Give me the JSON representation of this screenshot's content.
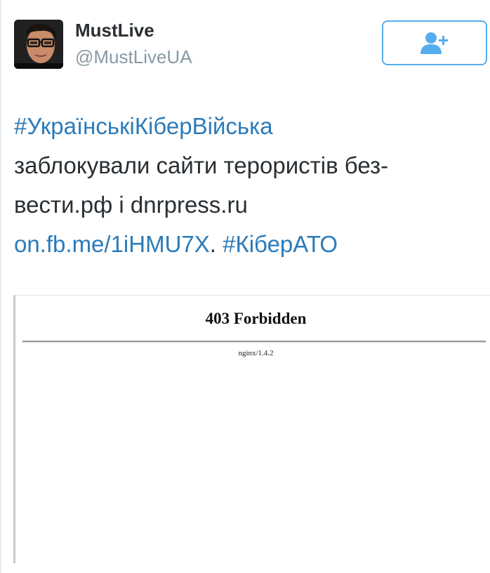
{
  "tweet": {
    "author": {
      "display_name": "MustLive",
      "handle": "@MustLiveUA"
    },
    "follow_icon": "add-user-icon",
    "text": {
      "hashtag_1": "#УкраїнськіКіберВійська",
      "line_2": "заблокували сайти терористів без-",
      "line_3": "вести.рф і dnrpress.ru",
      "link": "on.fb.me/1iHMU7X",
      "separator": ".",
      "hashtag_2": "#КіберАТО"
    },
    "media": {
      "title": "403 Forbidden",
      "server": "nginx/1.4.2"
    }
  },
  "colors": {
    "link": "#2b7bb9",
    "accent": "#55acee",
    "text": "#292f33",
    "muted": "#8899a6"
  }
}
